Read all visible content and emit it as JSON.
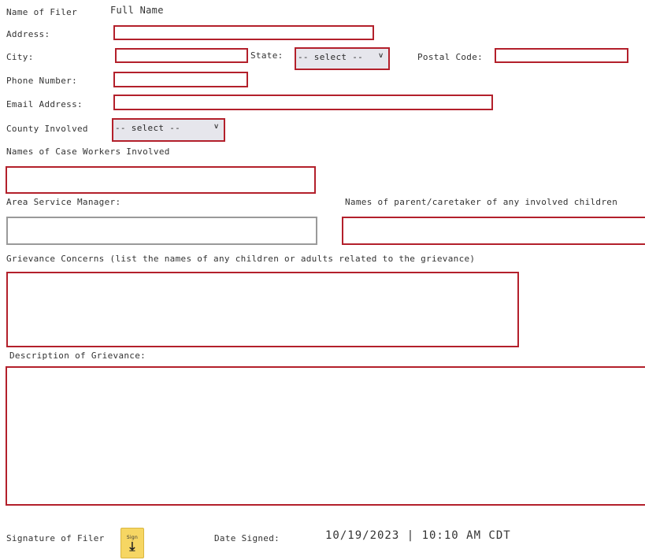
{
  "form": {
    "name_of_filer_label": "Name of Filer",
    "name_of_filer_value": "Full Name",
    "address_label": "Address:",
    "city_label": "City:",
    "state_label": "State:",
    "state_select_value": "-- select --",
    "postal_code_label": "Postal Code:",
    "phone_label": "Phone Number:",
    "email_label": "Email Address:",
    "county_label": "County Involved",
    "county_select_value": "-- select --",
    "case_workers_label": "Names of  Case Workers Involved",
    "area_manager_label": "Area Service Manager:",
    "parent_label": "Names of parent/caretaker of any involved children",
    "grievance_concerns_label": "Grievance Concerns (list the names of any children or adults related to the grievance)",
    "description_label": "Description of Grievance:",
    "signature_label": "Signature of Filer",
    "sign_button_label": "Sign",
    "sign_icon": "download-arrow-icon",
    "date_signed_label": "Date Signed:",
    "date_signed_value": "10/19/2023 | 10:10 AM CDT"
  },
  "colors": {
    "required_border": "#b3202b",
    "optional_border": "#9a9a9a",
    "sign_button": "#f6d663"
  }
}
